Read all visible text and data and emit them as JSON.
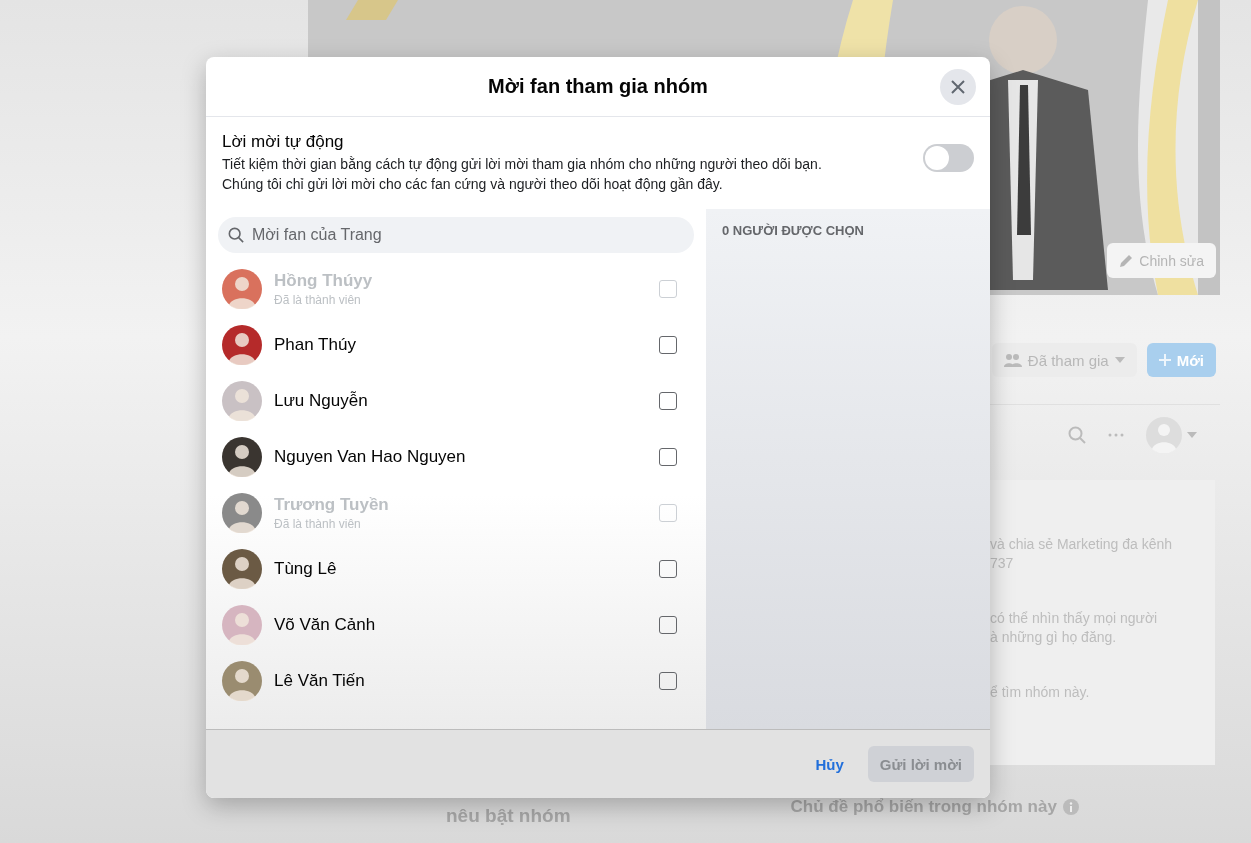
{
  "background_page": {
    "edit_cover_button": "Chỉnh sửa",
    "joined_button": "Đã tham gia",
    "new_button": "Mới",
    "about_paragraphs": [
      [
        "và chia sẻ Marketing đa kênh",
        "737"
      ],
      [
        "có thể nhìn thấy mọi người",
        "à những gì họ đăng."
      ],
      [
        "ể tìm nhóm này."
      ]
    ],
    "highlight_heading": "nêu bật nhóm",
    "popular_topics_heading": "Chủ đề phổ biến trong nhóm này"
  },
  "dialog": {
    "title": "Mời fan tham gia nhóm",
    "auto_invite": {
      "title": "Lời mời tự động",
      "description": [
        "Tiết kiệm thời gian bằng cách tự động gửi lời mời tham gia nhóm cho những người theo dõi bạn.",
        "Chúng tôi chỉ gửi lời mời cho các fan cứng và người theo dõi hoạt động gần đây."
      ],
      "on": false
    },
    "search": {
      "placeholder": "Mời fan của Trang"
    },
    "fans": [
      {
        "name": "Hồng Thúyy",
        "status": "Đã là thành viên",
        "disabled": true,
        "checked": false
      },
      {
        "name": "Phan Thúy",
        "disabled": false,
        "checked": false
      },
      {
        "name": "Lưu Nguyễn",
        "disabled": false,
        "checked": false
      },
      {
        "name": "Nguyen Van Hao Nguyen",
        "disabled": false,
        "checked": false
      },
      {
        "name": "Trương Tuyền",
        "status": "Đã là thành viên",
        "disabled": true,
        "checked": false
      },
      {
        "name": "Tùng Lê",
        "disabled": false,
        "checked": false
      },
      {
        "name": "Võ Văn Cảnh",
        "disabled": false,
        "checked": false
      },
      {
        "name": "Lê Văn Tiến",
        "disabled": false,
        "checked": false
      }
    ],
    "selected_count": "0 NGƯỜI ĐƯỢC CHỌN",
    "buttons": [
      {
        "label": "Hủy",
        "kind": "link",
        "disabled": false
      },
      {
        "label": "Gửi lời mời",
        "kind": "primary",
        "disabled": true
      }
    ]
  }
}
